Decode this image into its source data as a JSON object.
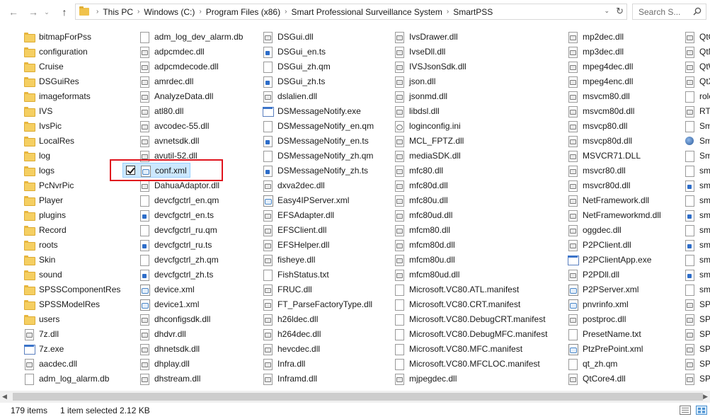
{
  "nav": {
    "back_icon": "←",
    "forward_icon": "→",
    "recent_icon": "⌄",
    "up_icon": "↑"
  },
  "address": {
    "crumbs": [
      "This PC",
      "Windows (C:)",
      "Program Files (x86)",
      "Smart Professional Surveillance System",
      "SmartPSS"
    ],
    "dropdown_icon": "⌄",
    "refresh_icon": "↻"
  },
  "search": {
    "placeholder": "Search S...",
    "icon": "search-icon"
  },
  "columns": [
    [
      {
        "name": "bitmapForPss",
        "type": "folder"
      },
      {
        "name": "configuration",
        "type": "folder"
      },
      {
        "name": "Cruise",
        "type": "folder"
      },
      {
        "name": "DSGuiRes",
        "type": "folder"
      },
      {
        "name": "imageformats",
        "type": "folder"
      },
      {
        "name": "IVS",
        "type": "folder"
      },
      {
        "name": "IvsPic",
        "type": "folder"
      },
      {
        "name": "LocalRes",
        "type": "folder"
      },
      {
        "name": "log",
        "type": "folder"
      },
      {
        "name": "logs",
        "type": "folder"
      },
      {
        "name": "PcNvrPic",
        "type": "folder"
      },
      {
        "name": "Player",
        "type": "folder"
      },
      {
        "name": "plugins",
        "type": "folder"
      },
      {
        "name": "Record",
        "type": "folder"
      },
      {
        "name": "roots",
        "type": "folder"
      },
      {
        "name": "Skin",
        "type": "folder"
      },
      {
        "name": "sound",
        "type": "folder"
      },
      {
        "name": "SPSSComponentRes",
        "type": "folder"
      },
      {
        "name": "SPSSModelRes",
        "type": "folder"
      },
      {
        "name": "users",
        "type": "folder"
      },
      {
        "name": "7z.dll",
        "type": "dll"
      },
      {
        "name": "7z.exe",
        "type": "exe"
      },
      {
        "name": "aacdec.dll",
        "type": "dll"
      },
      {
        "name": "adm_log_alarm.db",
        "type": "file"
      }
    ],
    [
      {
        "name": "adm_log_dev_alarm.db",
        "type": "file"
      },
      {
        "name": "adpcmdec.dll",
        "type": "dll"
      },
      {
        "name": "adpcmdecode.dll",
        "type": "dll"
      },
      {
        "name": "amrdec.dll",
        "type": "dll"
      },
      {
        "name": "AnalyzeData.dll",
        "type": "dll"
      },
      {
        "name": "atl80.dll",
        "type": "dll"
      },
      {
        "name": "avcodec-55.dll",
        "type": "dll"
      },
      {
        "name": "avnetsdk.dll",
        "type": "dll"
      },
      {
        "name": "avutil-52.dll",
        "type": "dll"
      },
      {
        "name": "conf.xml",
        "type": "xml",
        "selected": true
      },
      {
        "name": "DahuaAdaptor.dll",
        "type": "dll"
      },
      {
        "name": "devcfgctrl_en.qm",
        "type": "file"
      },
      {
        "name": "devcfgctrl_en.ts",
        "type": "ts"
      },
      {
        "name": "devcfgctrl_ru.qm",
        "type": "file"
      },
      {
        "name": "devcfgctrl_ru.ts",
        "type": "ts"
      },
      {
        "name": "devcfgctrl_zh.qm",
        "type": "file"
      },
      {
        "name": "devcfgctrl_zh.ts",
        "type": "ts"
      },
      {
        "name": "device.xml",
        "type": "xml"
      },
      {
        "name": "device1.xml",
        "type": "xml"
      },
      {
        "name": "dhconfigsdk.dll",
        "type": "dll"
      },
      {
        "name": "dhdvr.dll",
        "type": "dll"
      },
      {
        "name": "dhnetsdk.dll",
        "type": "dll"
      },
      {
        "name": "dhplay.dll",
        "type": "dll"
      },
      {
        "name": "dhstream.dll",
        "type": "dll"
      }
    ],
    [
      {
        "name": "DSGui.dll",
        "type": "dll"
      },
      {
        "name": "DSGui_en.ts",
        "type": "ts"
      },
      {
        "name": "DSGui_zh.qm",
        "type": "file"
      },
      {
        "name": "DSGui_zh.ts",
        "type": "ts"
      },
      {
        "name": "dslalien.dll",
        "type": "dll"
      },
      {
        "name": "DSMessageNotify.exe",
        "type": "exe"
      },
      {
        "name": "DSMessageNotify_en.qm",
        "type": "file"
      },
      {
        "name": "DSMessageNotify_en.ts",
        "type": "ts"
      },
      {
        "name": "DSMessageNotify_zh.qm",
        "type": "file"
      },
      {
        "name": "DSMessageNotify_zh.ts",
        "type": "ts"
      },
      {
        "name": "dxva2dec.dll",
        "type": "dll"
      },
      {
        "name": "Easy4IPServer.xml",
        "type": "xml"
      },
      {
        "name": "EFSAdapter.dll",
        "type": "dll"
      },
      {
        "name": "EFSClient.dll",
        "type": "dll"
      },
      {
        "name": "EFSHelper.dll",
        "type": "dll"
      },
      {
        "name": "fisheye.dll",
        "type": "dll"
      },
      {
        "name": "FishStatus.txt",
        "type": "file"
      },
      {
        "name": "FRUC.dll",
        "type": "dll"
      },
      {
        "name": "FT_ParseFactoryType.dll",
        "type": "dll"
      },
      {
        "name": "h26ldec.dll",
        "type": "dll"
      },
      {
        "name": "h264dec.dll",
        "type": "dll"
      },
      {
        "name": "hevcdec.dll",
        "type": "dll"
      },
      {
        "name": "Infra.dll",
        "type": "dll"
      },
      {
        "name": "Inframd.dll",
        "type": "dll"
      }
    ],
    [
      {
        "name": "IvsDrawer.dll",
        "type": "dll"
      },
      {
        "name": "IvseDll.dll",
        "type": "dll"
      },
      {
        "name": "IVSJsonSdk.dll",
        "type": "dll"
      },
      {
        "name": "json.dll",
        "type": "dll"
      },
      {
        "name": "jsonmd.dll",
        "type": "dll"
      },
      {
        "name": "libdsl.dll",
        "type": "dll"
      },
      {
        "name": "loginconfig.ini",
        "type": "ini"
      },
      {
        "name": "MCL_FPTZ.dll",
        "type": "dll"
      },
      {
        "name": "mediaSDK.dll",
        "type": "dll"
      },
      {
        "name": "mfc80.dll",
        "type": "dll"
      },
      {
        "name": "mfc80d.dll",
        "type": "dll"
      },
      {
        "name": "mfc80u.dll",
        "type": "dll"
      },
      {
        "name": "mfc80ud.dll",
        "type": "dll"
      },
      {
        "name": "mfcm80.dll",
        "type": "dll"
      },
      {
        "name": "mfcm80d.dll",
        "type": "dll"
      },
      {
        "name": "mfcm80u.dll",
        "type": "dll"
      },
      {
        "name": "mfcm80ud.dll",
        "type": "dll"
      },
      {
        "name": "Microsoft.VC80.ATL.manifest",
        "type": "file"
      },
      {
        "name": "Microsoft.VC80.CRT.manifest",
        "type": "file"
      },
      {
        "name": "Microsoft.VC80.DebugCRT.manifest",
        "type": "file"
      },
      {
        "name": "Microsoft.VC80.DebugMFC.manifest",
        "type": "file"
      },
      {
        "name": "Microsoft.VC80.MFC.manifest",
        "type": "file"
      },
      {
        "name": "Microsoft.VC80.MFCLOC.manifest",
        "type": "file"
      },
      {
        "name": "mjpegdec.dll",
        "type": "dll"
      }
    ],
    [
      {
        "name": "mp2dec.dll",
        "type": "dll"
      },
      {
        "name": "mp3dec.dll",
        "type": "dll"
      },
      {
        "name": "mpeg4dec.dll",
        "type": "dll"
      },
      {
        "name": "mpeg4enc.dll",
        "type": "dll"
      },
      {
        "name": "msvcm80.dll",
        "type": "dll"
      },
      {
        "name": "msvcm80d.dll",
        "type": "dll"
      },
      {
        "name": "msvcp80.dll",
        "type": "dll"
      },
      {
        "name": "msvcp80d.dll",
        "type": "dll"
      },
      {
        "name": "MSVCR71.DLL",
        "type": "dll"
      },
      {
        "name": "msvcr80.dll",
        "type": "dll"
      },
      {
        "name": "msvcr80d.dll",
        "type": "dll"
      },
      {
        "name": "NetFramework.dll",
        "type": "dll"
      },
      {
        "name": "NetFrameworkmd.dll",
        "type": "dll"
      },
      {
        "name": "oggdec.dll",
        "type": "dll"
      },
      {
        "name": "P2PClient.dll",
        "type": "dll"
      },
      {
        "name": "P2PClientApp.exe",
        "type": "exe"
      },
      {
        "name": "P2PDll.dll",
        "type": "dll"
      },
      {
        "name": "P2PServer.xml",
        "type": "xml"
      },
      {
        "name": "pnvrinfo.xml",
        "type": "xml"
      },
      {
        "name": "postproc.dll",
        "type": "dll"
      },
      {
        "name": "PresetName.txt",
        "type": "file"
      },
      {
        "name": "PtzPrePoint.xml",
        "type": "xml"
      },
      {
        "name": "qt_zh.qm",
        "type": "file"
      },
      {
        "name": "QtCore4.dll",
        "type": "dll"
      }
    ],
    [
      {
        "name": "QtG",
        "type": "dll"
      },
      {
        "name": "QtN",
        "type": "dll"
      },
      {
        "name": "QtW",
        "type": "dll"
      },
      {
        "name": "QtX",
        "type": "dll"
      },
      {
        "name": "role",
        "type": "file"
      },
      {
        "name": "RTP",
        "type": "dll"
      },
      {
        "name": "Sma",
        "type": "file"
      },
      {
        "name": "Sma",
        "type": "app"
      },
      {
        "name": "Sma",
        "type": "file"
      },
      {
        "name": "sma",
        "type": "file"
      },
      {
        "name": "sma",
        "type": "ts"
      },
      {
        "name": "sma",
        "type": "file"
      },
      {
        "name": "sma",
        "type": "ts"
      },
      {
        "name": "sma",
        "type": "file"
      },
      {
        "name": "sma",
        "type": "ts"
      },
      {
        "name": "sma",
        "type": "file"
      },
      {
        "name": "sma",
        "type": "ts"
      },
      {
        "name": "sma",
        "type": "file"
      },
      {
        "name": "SPS",
        "type": "dll"
      },
      {
        "name": "SPS",
        "type": "dll"
      },
      {
        "name": "SPS",
        "type": "dll"
      },
      {
        "name": "SPS",
        "type": "dll"
      },
      {
        "name": "SPS",
        "type": "dll"
      },
      {
        "name": "SPS",
        "type": "dll"
      }
    ]
  ],
  "scrollbar": {
    "left_icon": "◀",
    "right_icon": "▶"
  },
  "status": {
    "item_count": "179 items",
    "selection": "1 item selected  2.12 KB"
  }
}
